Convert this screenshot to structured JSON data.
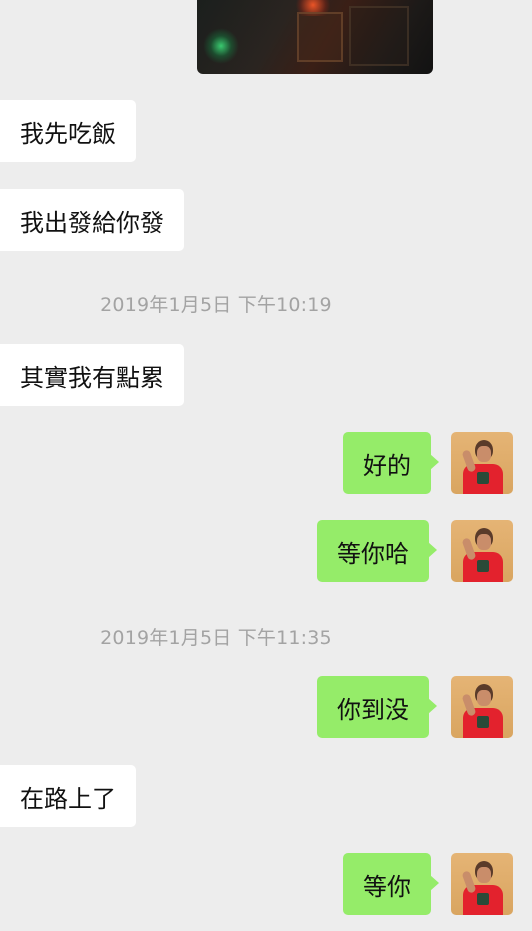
{
  "colors": {
    "background": "#ededed",
    "incoming_bubble": "#ffffff",
    "outgoing_bubble": "#95ec69",
    "timestamp_text": "#a3a3a3"
  },
  "image_message": {
    "icon": "photo-thumbnail"
  },
  "messages": [
    {
      "side": "left",
      "text": "我先吃飯"
    },
    {
      "side": "left",
      "text": "我出發給你發"
    },
    {
      "type": "timestamp",
      "text": "2019年1月5日 下午10:19"
    },
    {
      "side": "left",
      "text": "其實我有點累"
    },
    {
      "side": "right",
      "text": "好的",
      "avatar": "user-avatar"
    },
    {
      "side": "right",
      "text": "等你哈",
      "avatar": "user-avatar"
    },
    {
      "type": "timestamp",
      "text": "2019年1月5日 下午11:35"
    },
    {
      "side": "right",
      "text": "你到没",
      "avatar": "user-avatar"
    },
    {
      "side": "left",
      "text": "在路上了"
    },
    {
      "side": "right",
      "text": "等你",
      "avatar": "user-avatar"
    }
  ]
}
